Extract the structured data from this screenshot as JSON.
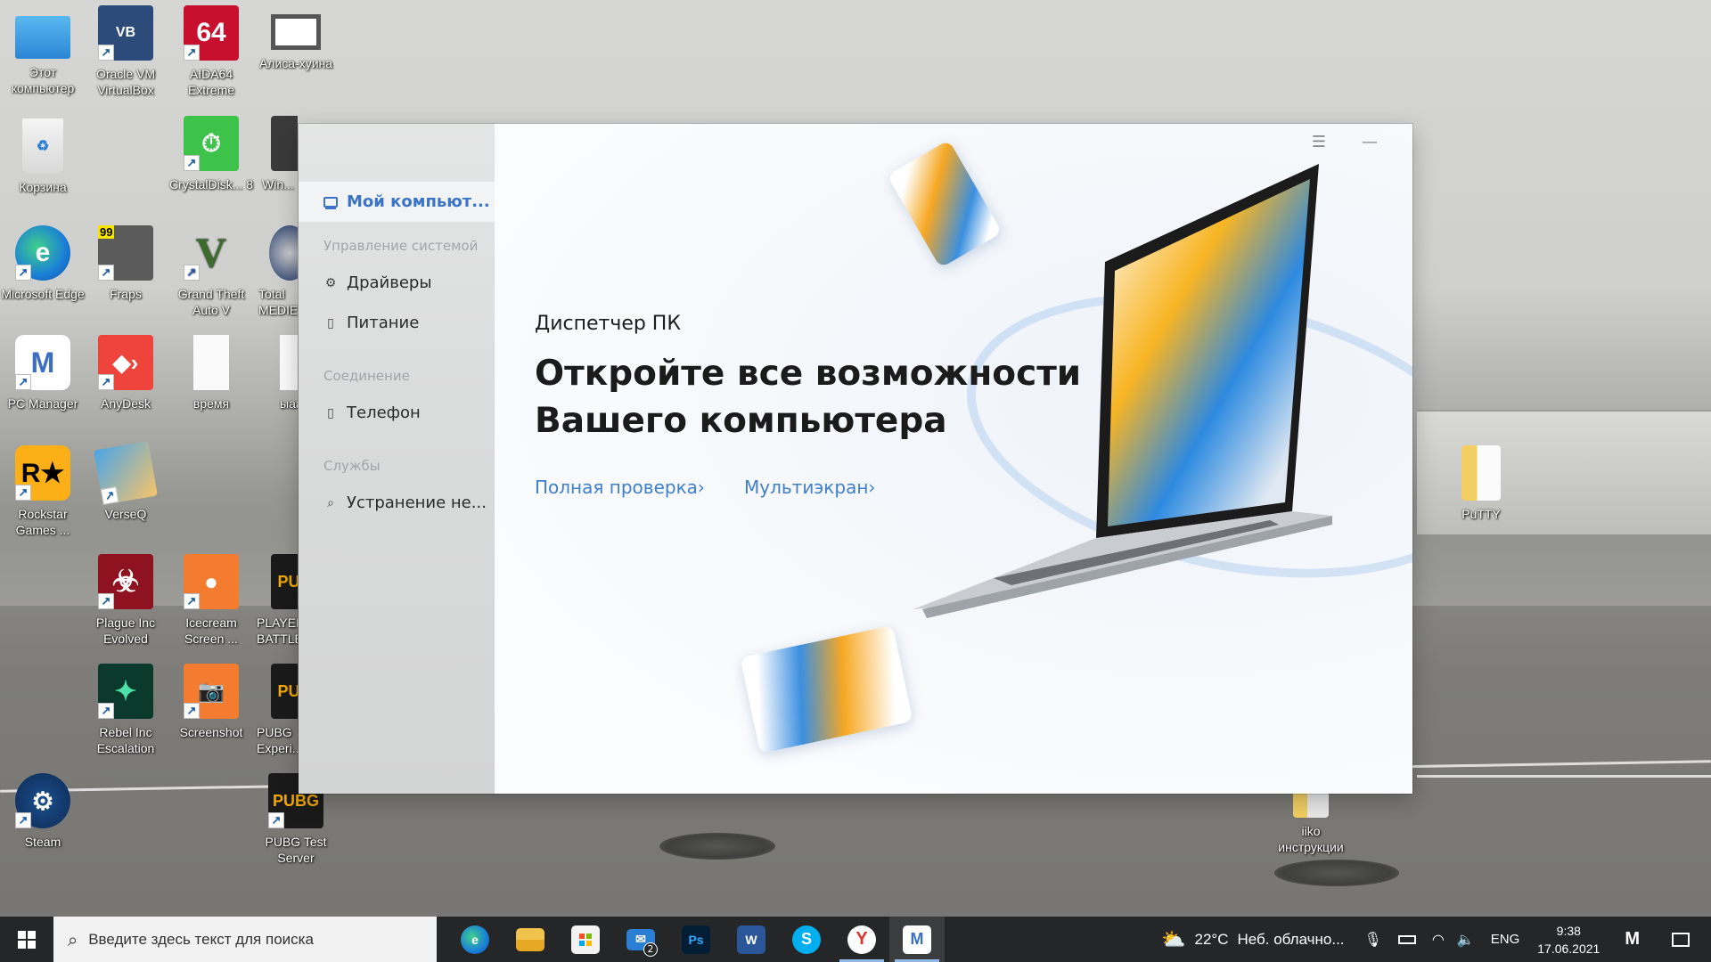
{
  "desktop": {
    "icons": [
      {
        "label": "Этот компьютер",
        "icon": "computer-icon"
      },
      {
        "label": "Oracle VM VirtualBox",
        "icon": "virtualbox-icon"
      },
      {
        "label": "AIDA64 Extreme",
        "icon": "aida64-icon"
      },
      {
        "label": "Алиса-хуина",
        "icon": "video-file-icon"
      },
      {
        "label": "Корзина",
        "icon": "recycle-bin-icon"
      },
      {
        "label": "CrystalDisk... 8",
        "icon": "crystaldisk-icon"
      },
      {
        "label": "Win...",
        "icon": "winrar-icon"
      },
      {
        "label": "Microsoft Edge",
        "icon": "edge-icon"
      },
      {
        "label": "Fraps",
        "icon": "fraps-icon"
      },
      {
        "label": "Grand Theft Auto V",
        "icon": "gta-icon"
      },
      {
        "label": "Total MEDIEV...",
        "icon": "total-war-icon"
      },
      {
        "label": "PC Manager",
        "icon": "pc-manager-icon"
      },
      {
        "label": "AnyDesk",
        "icon": "anydesk-icon"
      },
      {
        "label": "время",
        "icon": "text-file-icon"
      },
      {
        "label": "ыаа",
        "icon": "text-file-icon"
      },
      {
        "label": "Rockstar Games ...",
        "icon": "rockstar-icon"
      },
      {
        "label": "VerseQ",
        "icon": "verseq-icon"
      },
      {
        "label": "Plague Inc Evolved",
        "icon": "plague-icon"
      },
      {
        "label": "Icecream Screen ...",
        "icon": "icecream-icon"
      },
      {
        "label": "PLAYER... BATTLE...",
        "icon": "pubg-icon"
      },
      {
        "label": "Rebel Inc Escalation",
        "icon": "rebel-inc-icon"
      },
      {
        "label": "Screenshot",
        "icon": "screenshot-icon"
      },
      {
        "label": "PUBG Experi...",
        "icon": "pubg-exp-icon"
      },
      {
        "label": "Steam",
        "icon": "steam-icon"
      },
      {
        "label": "PUBG Test Server",
        "icon": "pubg-test-icon"
      },
      {
        "label": "PuTTY",
        "icon": "folder-icon"
      },
      {
        "label": "iiko инструкции",
        "icon": "folder-icon"
      }
    ]
  },
  "app": {
    "sidebar": {
      "active_item": "Мой компьют...",
      "sections": [
        {
          "title": "Управление системой",
          "items": [
            "Драйверы",
            "Питание"
          ]
        },
        {
          "title": "Соединение",
          "items": [
            "Телефон"
          ]
        },
        {
          "title": "Службы",
          "items": [
            "Устранение не..."
          ]
        }
      ]
    },
    "window_controls": {
      "menu": "☰",
      "minimize": "—",
      "close": "✕"
    },
    "main": {
      "subtitle": "Диспетчер ПК",
      "headline_line1": "Откройте все возможности",
      "headline_line2": "Вашего компьютера",
      "link_full_check": "Полная проверка",
      "link_multiscreen": "Мультиэкран",
      "chevron": "›"
    },
    "colors": {
      "accent": "#3f7fcb",
      "active_nav": "#3a74c8"
    }
  },
  "taskbar": {
    "search_placeholder": "Введите здесь текст для поиска",
    "apps": [
      {
        "name": "Microsoft Edge",
        "icon": "edge-icon",
        "running": false
      },
      {
        "name": "File Explorer",
        "icon": "folder-icon",
        "running": false
      },
      {
        "name": "Microsoft Store",
        "icon": "store-icon",
        "running": false
      },
      {
        "name": "Mail",
        "icon": "mail-icon",
        "badge": "2",
        "running": false
      },
      {
        "name": "Photoshop",
        "icon": "photoshop-icon",
        "glyph": "Ps",
        "running": false
      },
      {
        "name": "Word",
        "icon": "word-icon",
        "glyph": "W",
        "running": false
      },
      {
        "name": "Skype",
        "icon": "skype-icon",
        "glyph": "S",
        "running": false
      },
      {
        "name": "Yandex Browser",
        "icon": "yandex-icon",
        "glyph": "Y",
        "running": true
      },
      {
        "name": "PC Manager",
        "icon": "pc-manager-icon",
        "glyph": "M",
        "running": true,
        "active": true
      }
    ],
    "weather": {
      "temp": "22°C",
      "desc": "Неб. облачно..."
    },
    "language": "ENG",
    "time": "9:38",
    "date": "17.06.2021"
  }
}
